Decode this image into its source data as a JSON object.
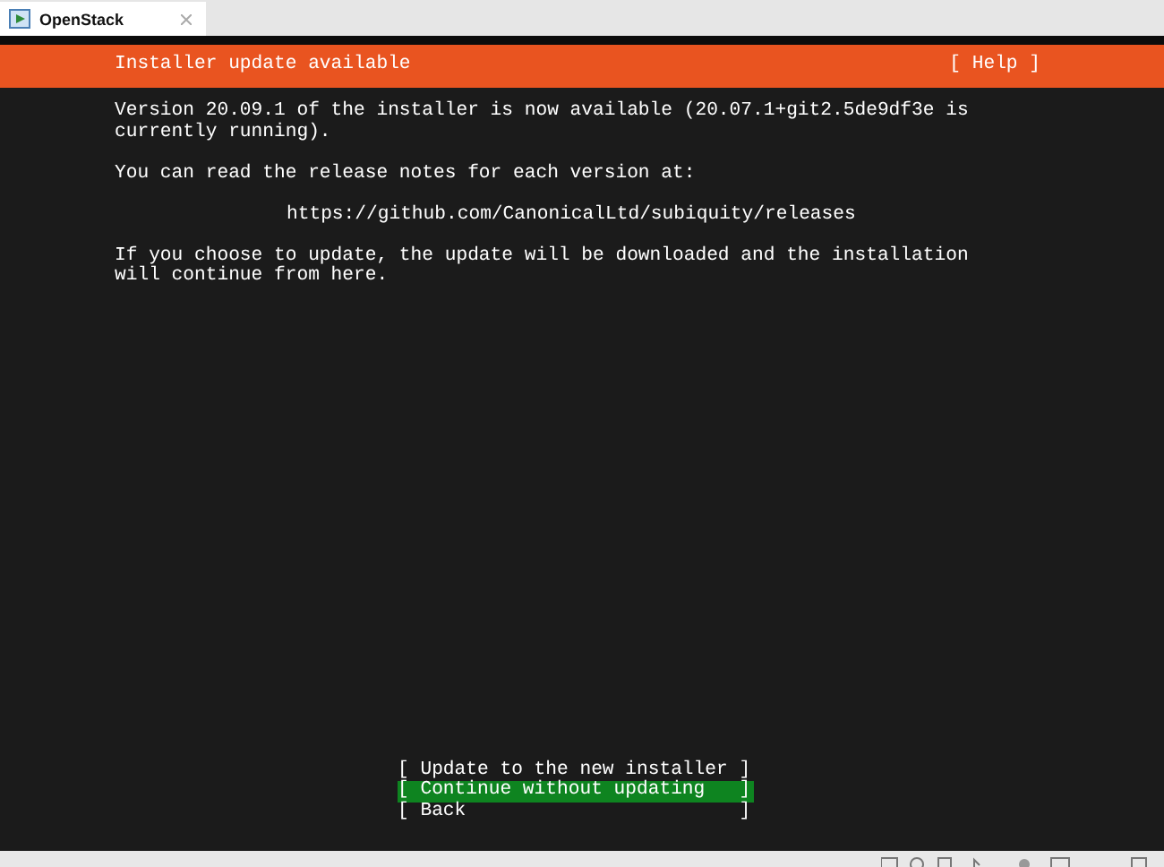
{
  "window": {
    "tab": {
      "title": "OpenStack",
      "selected": true
    }
  },
  "header": {
    "title": "Installer update available",
    "help": "[ Help ]"
  },
  "paragraphs": [
    {
      "kind": "text",
      "text": "Version 20.09.1 of the installer is now available (20.07.1+git2.5de9df3e is\ncurrently running)."
    },
    {
      "kind": "text",
      "text": "You can read the release notes for each version at:"
    },
    {
      "kind": "link",
      "text": "https://github.com/CanonicalLtd/subiquity/releases"
    },
    {
      "kind": "text",
      "text": "If you choose to update, the update will be downloaded and the installation\nwill continue from here."
    }
  ],
  "buttons": [
    {
      "label": "[ Update to the new installer ]",
      "selected": false
    },
    {
      "label": "[ Continue without updating   ]",
      "selected": true
    },
    {
      "label": "[ Back                        ]",
      "selected": false
    }
  ]
}
